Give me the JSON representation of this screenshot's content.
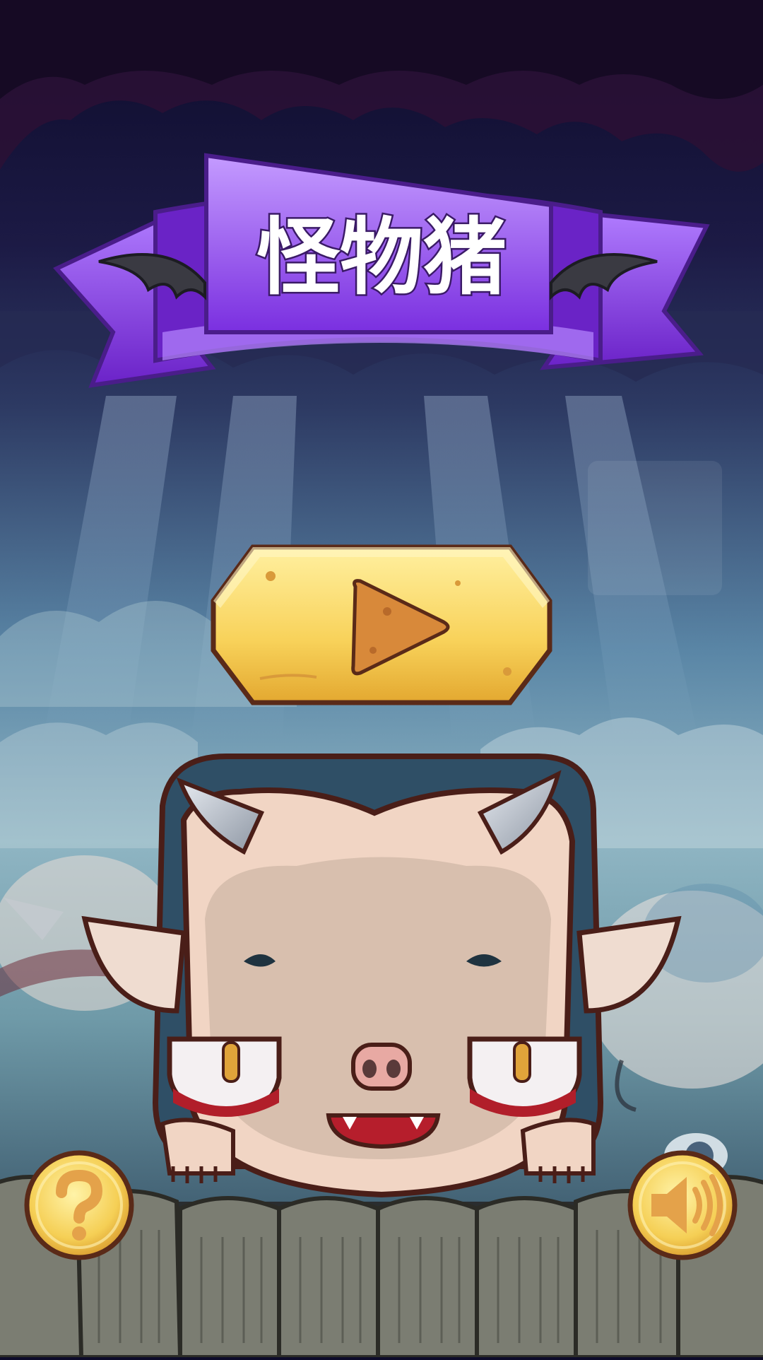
{
  "game": {
    "title": "怪物猪"
  },
  "buttons": {
    "play_icon": "play-icon",
    "help_icon": "question-icon",
    "sound_icon": "speaker-icon"
  },
  "colors": {
    "banner_purple": "#8a3fe0",
    "button_yellow": "#f7d55b",
    "outline_brown": "#5a2a18"
  }
}
